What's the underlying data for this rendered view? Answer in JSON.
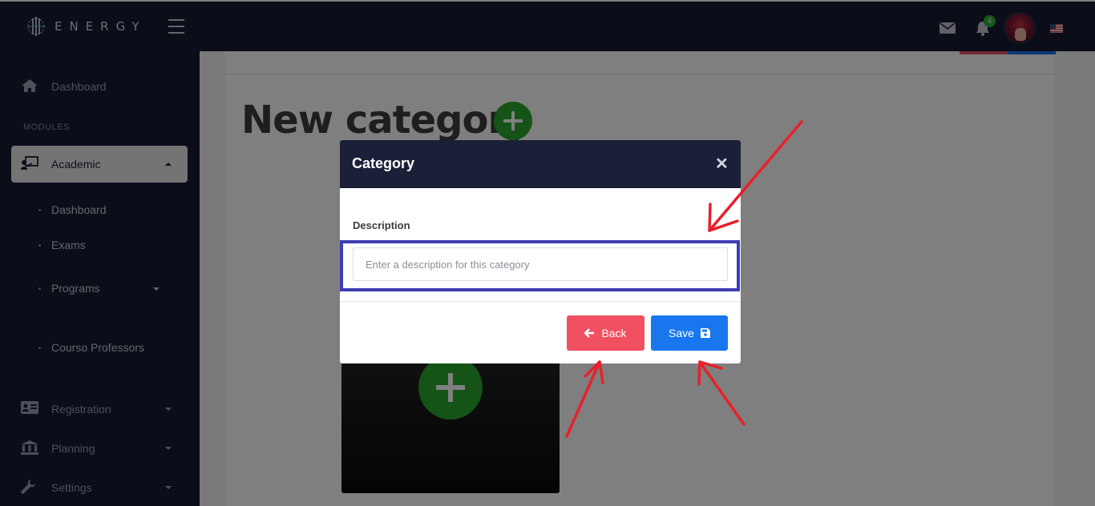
{
  "header": {
    "brand": "ENERGY",
    "notification_count": "4"
  },
  "sidebar": {
    "dashboard_label": "Dashboard",
    "section_label": "MODULES",
    "academic_label": "Academic",
    "sub_items": [
      "Dashboard",
      "Exams",
      "Programs",
      "Courso Professors"
    ],
    "registration_label": "Registration",
    "planning_label": "Planning",
    "settings_label": "Settings"
  },
  "main": {
    "page_title": "New category"
  },
  "modal": {
    "title": "Category",
    "close_symbol": "✕",
    "description_label": "Description",
    "description_placeholder": "Enter a description for this category",
    "description_value": "",
    "back_label": "Back",
    "save_label": "Save"
  },
  "colors": {
    "header_bg": "#161c33",
    "sidebar_bg": "#161c33",
    "accent_green": "#2aa62c",
    "back_button": "#f0505f",
    "save_button": "#1877ee",
    "highlight_border": "#3d3db5",
    "annotation_arrow": "#e8202a"
  },
  "icons": {
    "header": [
      "logo-icon",
      "hamburger-icon",
      "mail-icon",
      "bell-icon",
      "avatar",
      "us-flag-icon"
    ],
    "sidebar": [
      "home-icon",
      "teacher-icon",
      "id-card-icon",
      "bank-icon",
      "wrench-icon"
    ],
    "buttons": [
      "arrow-left-icon",
      "floppy-disk-icon"
    ]
  }
}
